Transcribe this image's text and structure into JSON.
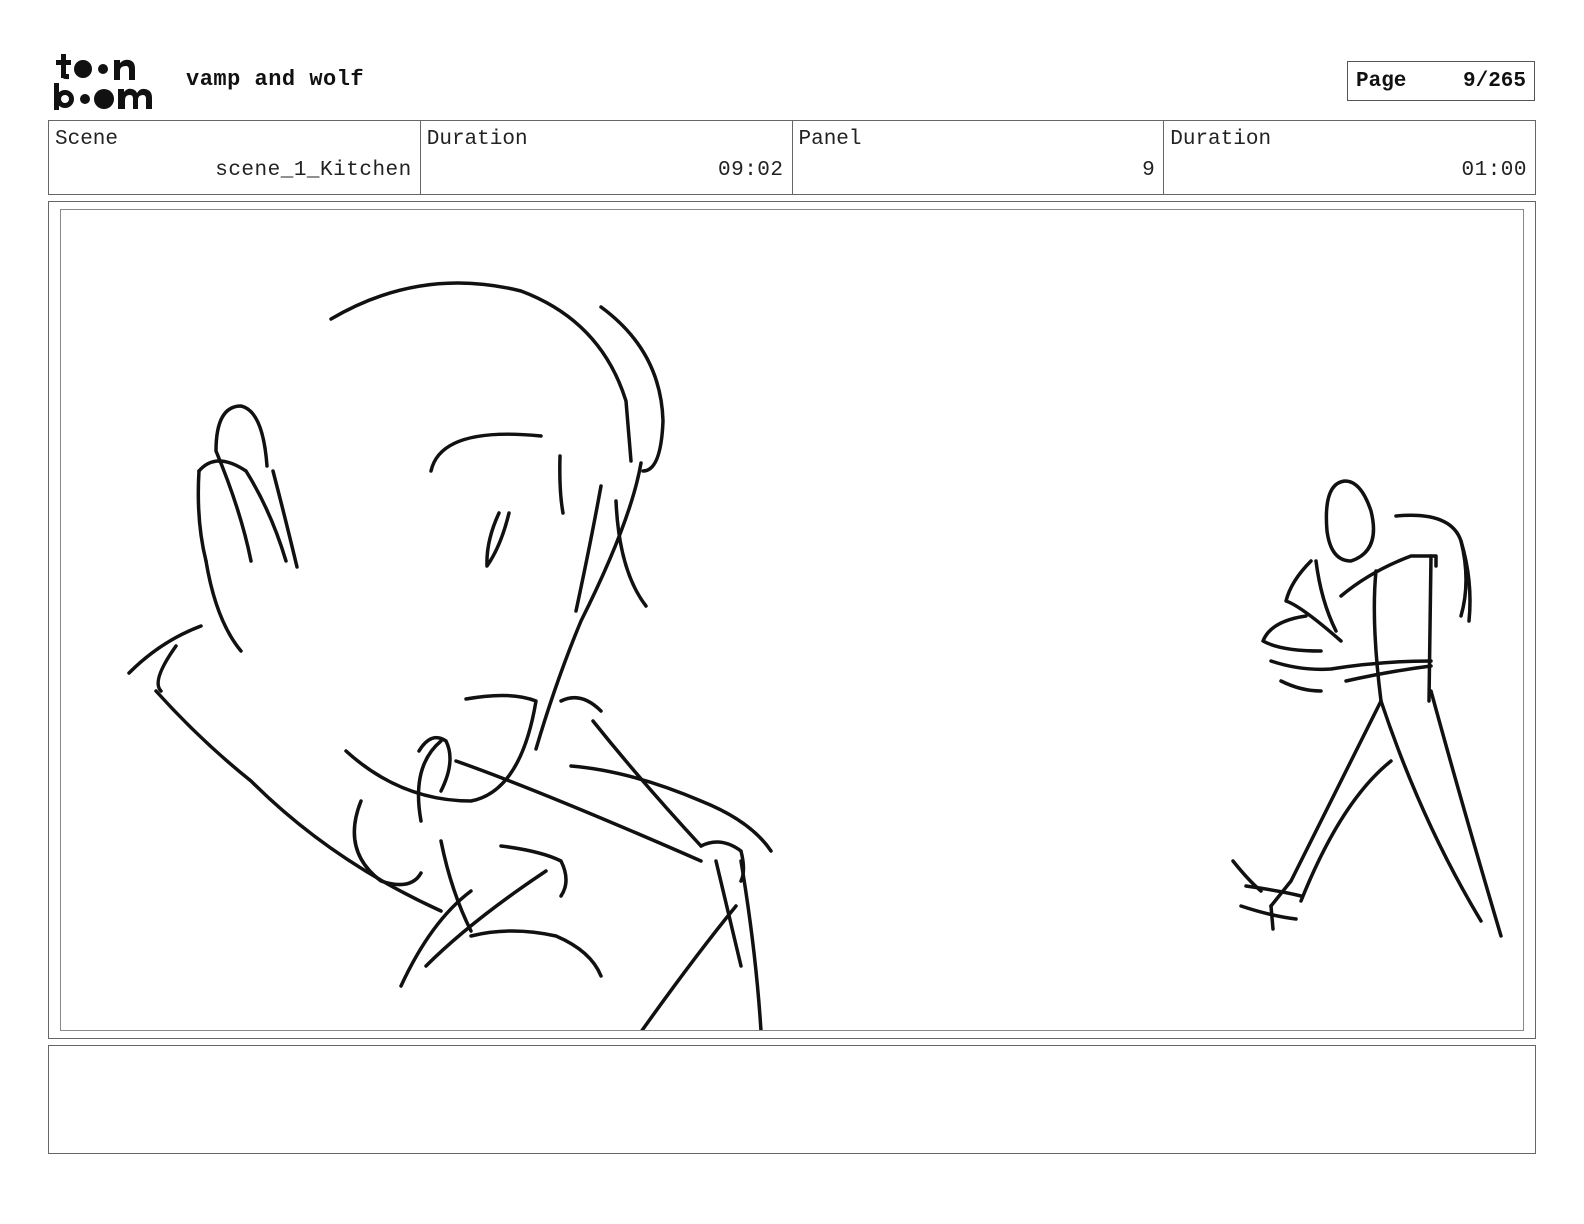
{
  "header": {
    "logo_text": "toon boom",
    "project_title": "vamp and wolf",
    "page_label": "Page",
    "page_value": "9/265"
  },
  "info": {
    "scene_label": "Scene",
    "scene_value": "scene_1_Kitchen",
    "scene_duration_label": "Duration",
    "scene_duration_value": "09:02",
    "panel_label": "Panel",
    "panel_value": "9",
    "panel_duration_label": "Duration",
    "panel_duration_value": "01:00"
  },
  "notes": {
    "text": ""
  }
}
